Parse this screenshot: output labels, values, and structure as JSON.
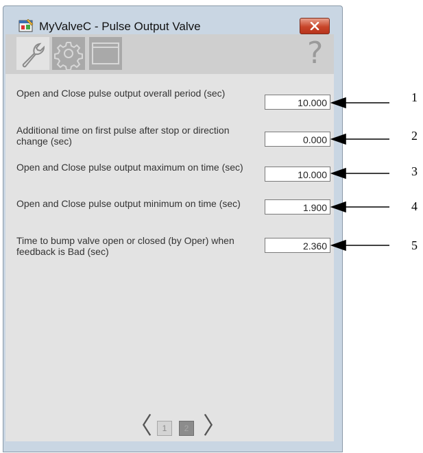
{
  "window": {
    "title": "MyValveC - Pulse Output Valve"
  },
  "tabs": [
    {
      "name": "maintenance",
      "icon": "wrench-icon",
      "active": true
    },
    {
      "name": "engineering",
      "icon": "gear-icon",
      "active": false
    },
    {
      "name": "display",
      "icon": "window-icon",
      "active": false
    }
  ],
  "help": {
    "glyph": "?"
  },
  "params": [
    {
      "label": "Open and Close pulse output overall period (sec)",
      "value": "10.000"
    },
    {
      "label": "Additional time on first pulse after stop or direction change (sec)",
      "value": "0.000"
    },
    {
      "label": "Open and Close pulse output maximum on time (sec)",
      "value": "10.000"
    },
    {
      "label": "Open and Close pulse output minimum on time (sec)",
      "value": "1.900"
    },
    {
      "label": "Time to bump valve open or closed (by Oper) when feedback is Bad (sec)",
      "value": "2.360"
    }
  ],
  "pager": {
    "prev": "〈",
    "next": "〉",
    "pages": [
      "1",
      "2"
    ],
    "current": "2"
  },
  "callouts": [
    "1",
    "2",
    "3",
    "4",
    "5"
  ],
  "colors": {
    "panel_background": "#e3e3e3",
    "window_frame": "#c9d6e3",
    "close_button": "#c8452a"
  }
}
